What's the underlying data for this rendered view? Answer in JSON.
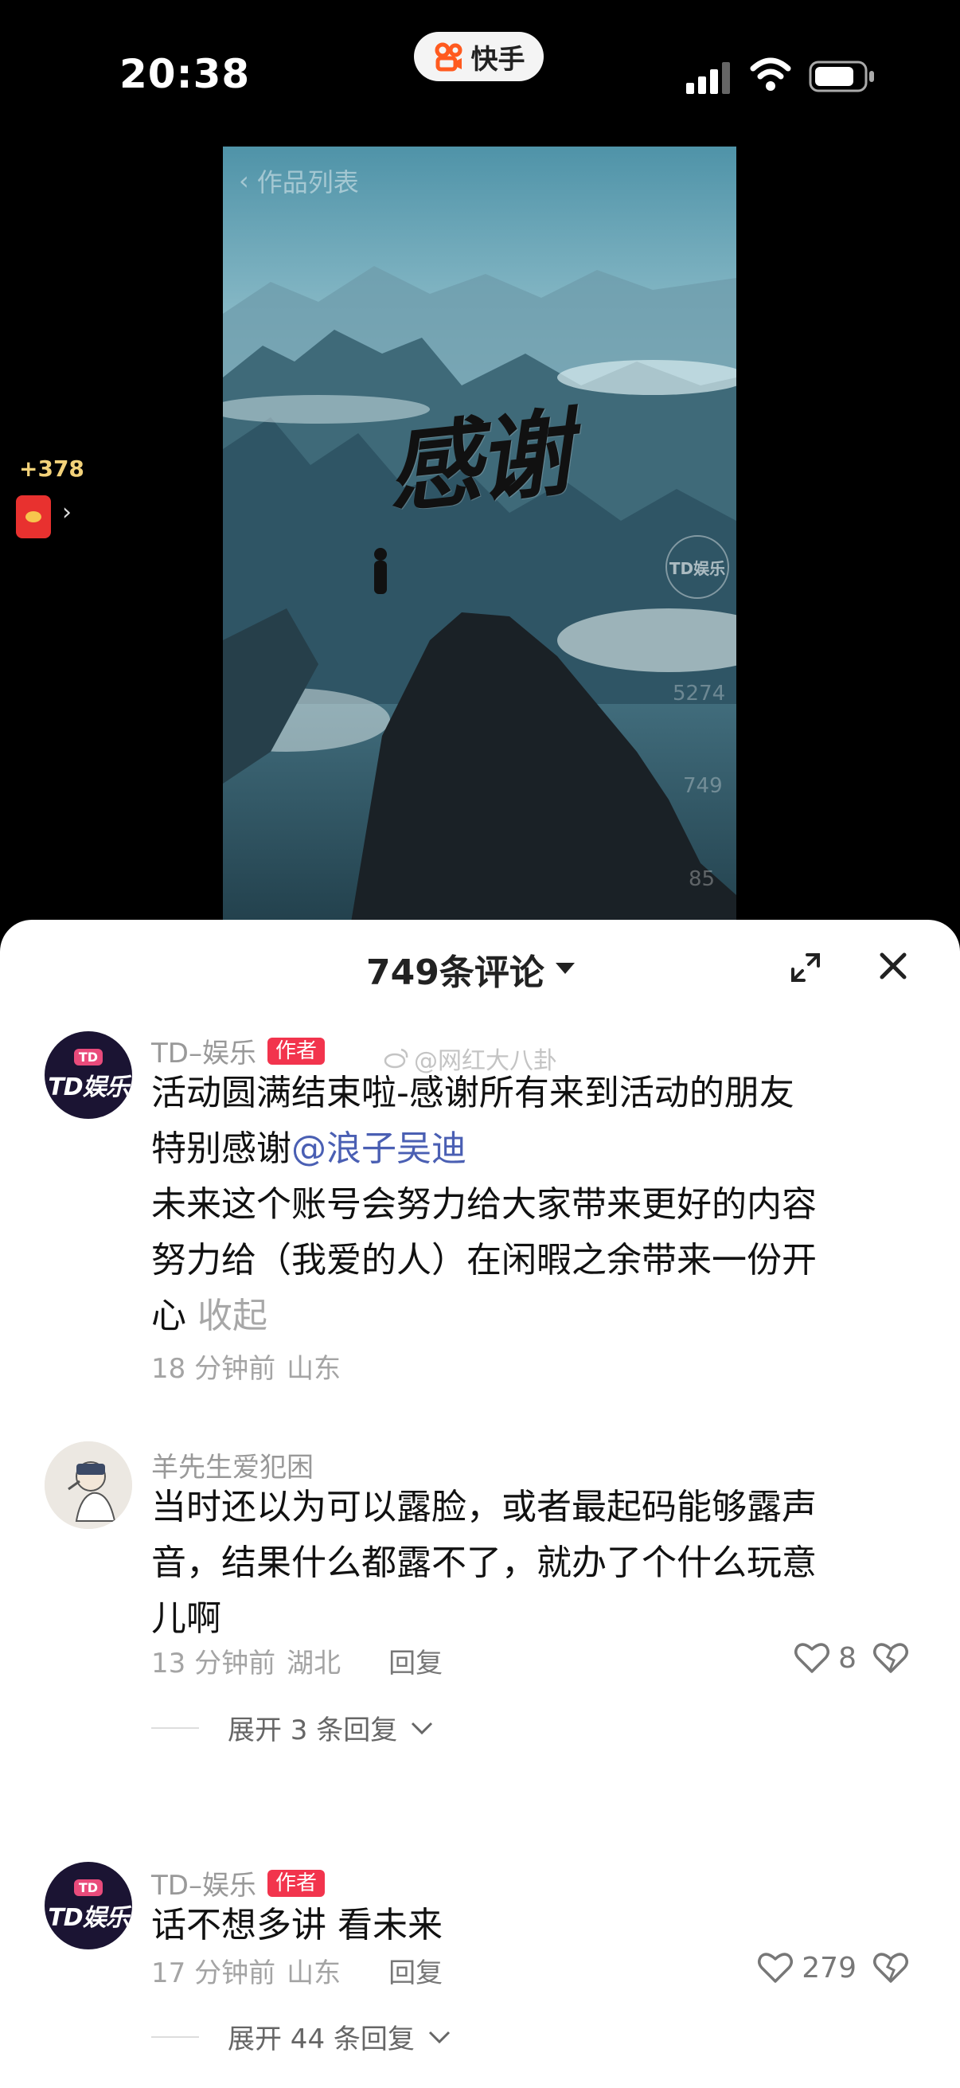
{
  "status_bar": {
    "time": "20:38",
    "app_pill_label": "快手"
  },
  "video": {
    "top_label": "作品列表",
    "title_text": "感谢",
    "watermark": "TD娱乐",
    "faint_count_1": "5274",
    "faint_count_2": "749",
    "faint_count_3": "85"
  },
  "side_reward": {
    "amount": "+378"
  },
  "comments_sheet": {
    "count_label": "749条评论",
    "comments": [
      {
        "username": "TD–娱乐",
        "badge": "作者",
        "watermark_text": "@网红大八卦",
        "text_line1": "活动圆满结束啦-感谢所有来到活动的朋友",
        "text_line2_prefix": "特别感谢",
        "mention": "@浪子吴迪",
        "text_line3": "未来这个账号会努力给大家带来更好的内容",
        "text_line4": "努力给（我爱的人）在闲暇之余带来一份开",
        "text_line5": "心",
        "collapse_label": "收起",
        "time": "18 分钟前",
        "location": "山东"
      },
      {
        "username": "羊先生爱犯困",
        "text_line1": "当时还以为可以露脸，或者最起码能够露声",
        "text_line2": "音，结果什么都露不了，就办了个什么玩意",
        "text_line3": "儿啊",
        "time": "13 分钟前",
        "location": "湖北",
        "reply_label": "回复",
        "likes": "8",
        "expand_label": "展开 3 条回复"
      },
      {
        "username": "TD–娱乐",
        "badge": "作者",
        "text_line1": "话不想多讲 看未来",
        "time": "17 分钟前",
        "location": "山东",
        "reply_label": "回复",
        "likes": "279",
        "expand_label": "展开 44 条回复"
      }
    ]
  },
  "colors": {
    "badge_red": "#f2344d",
    "mention_blue": "#4a5fb3"
  }
}
